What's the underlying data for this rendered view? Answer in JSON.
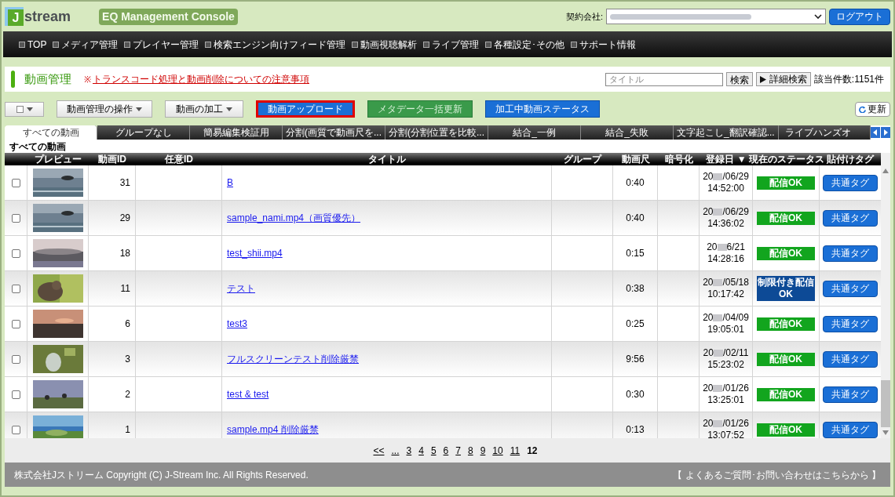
{
  "header": {
    "logo_mark": "J",
    "logo": "stream",
    "console_title": "EQ Management Console",
    "contract_label": "契約会社:",
    "logout": "ログアウト"
  },
  "nav": [
    "TOP",
    "メディア管理",
    "プレイヤー管理",
    "検索エンジン向けフィード管理",
    "動画視聴解析",
    "ライブ管理",
    "各種設定･その他",
    "サポート情報"
  ],
  "page_title": "動画管理",
  "notice_mark": "※",
  "notice_link": "トランスコード処理と動画削除についての注意事項",
  "search": {
    "placeholder": "タイトル",
    "button": "検索",
    "advanced": "詳細検索",
    "count": "該当件数:1151件"
  },
  "toolbar": [
    {
      "label": "動画管理の操作",
      "kind": "menu"
    },
    {
      "label": "動画の加工",
      "kind": "menu"
    },
    {
      "label": "動画アップロード",
      "kind": "highlight"
    },
    {
      "label": "メタデータ一括更新",
      "kind": "green"
    },
    {
      "label": "加工中動画ステータス",
      "kind": "blue"
    }
  ],
  "refresh": "更新",
  "tabs": [
    {
      "label": "すべての動画",
      "selected": true
    },
    {
      "label": "グループなし",
      "selected": false
    },
    {
      "label": "簡易編集検証用",
      "selected": false
    },
    {
      "label": "分割(画質で動画尺を...",
      "selected": false
    },
    {
      "label": "分割(分割位置を比較...",
      "selected": false
    },
    {
      "label": "結合_一例",
      "selected": false
    },
    {
      "label": "結合_失敗",
      "selected": false
    },
    {
      "label": "文字起こし_翻訳確認...",
      "selected": false
    },
    {
      "label": "ライブハンズオ",
      "selected": false
    }
  ],
  "tab_caption": "すべての動画",
  "table": {
    "columns": [
      "プレビュー",
      "動画ID",
      "任意ID",
      "タイトル",
      "グループ",
      "動画尺",
      "暗号化",
      "登録日 ▼",
      "現在のステータス",
      "貼付けタグ"
    ],
    "rows": [
      {
        "checked": false,
        "id": "31",
        "title": "B",
        "duration": "0:40",
        "date_start": "20",
        "date_end": "/06/29",
        "time": "14:52:00",
        "status": {
          "label": "配信OK",
          "color": "#12a51e"
        },
        "tag": "共通タグ"
      },
      {
        "checked": false,
        "id": "29",
        "title": "sample_nami.mp4（画質優先）",
        "duration": "0:40",
        "date_start": "20",
        "date_end": "/06/29",
        "time": "14:36:02",
        "status": {
          "label": "配信OK",
          "color": "#12a51e"
        },
        "tag": "共通タグ"
      },
      {
        "checked": false,
        "id": "18",
        "title": "test_shii.mp4",
        "duration": "0:15",
        "date_start": "20",
        "date_end": "6/21",
        "time": "14:28:16",
        "status": {
          "label": "配信OK",
          "color": "#12a51e"
        },
        "tag": "共通タグ"
      },
      {
        "checked": false,
        "id": "11",
        "title": "テスト",
        "duration": "0:38",
        "date_start": "20",
        "date_end": "/05/18",
        "time": "10:17:42",
        "status": {
          "label": "制限付き配信OK",
          "color": "#0d4a96"
        },
        "tag": "共通タグ"
      },
      {
        "checked": false,
        "id": "6",
        "title": "test3",
        "duration": "0:25",
        "date_start": "20",
        "date_end": "/04/09",
        "time": "19:05:01",
        "status": {
          "label": "配信OK",
          "color": "#12a51e"
        },
        "tag": "共通タグ"
      },
      {
        "checked": false,
        "id": "3",
        "title": "フルスクリーンテスト削除厳禁",
        "duration": "9:56",
        "date_start": "20",
        "date_end": "/02/11",
        "time": "15:23:02",
        "status": {
          "label": "配信OK",
          "color": "#12a51e"
        },
        "tag": "共通タグ"
      },
      {
        "checked": false,
        "id": "2",
        "title": "test & test",
        "duration": "0:30",
        "date_start": "20",
        "date_end": "/01/26",
        "time": "13:25:01",
        "status": {
          "label": "配信OK",
          "color": "#12a51e"
        },
        "tag": "共通タグ"
      },
      {
        "checked": false,
        "id": "1",
        "title": "sample.mp4 削除厳禁",
        "duration": "0:13",
        "date_start": "20",
        "date_end": "/01/26",
        "time": "13:07:52",
        "status": {
          "label": "配信OK",
          "color": "#12a51e"
        },
        "tag": "共通タグ"
      }
    ]
  },
  "pagination": [
    {
      "label": "<<",
      "selected": false
    },
    {
      "label": "...",
      "selected": false
    },
    {
      "label": "3",
      "selected": false
    },
    {
      "label": "4",
      "selected": false
    },
    {
      "label": "5",
      "selected": false
    },
    {
      "label": "6",
      "selected": false
    },
    {
      "label": "7",
      "selected": false
    },
    {
      "label": "8",
      "selected": false
    },
    {
      "label": "9",
      "selected": false
    },
    {
      "label": "10",
      "selected": false
    },
    {
      "label": "11",
      "selected": false
    },
    {
      "label": "12",
      "selected": true
    }
  ],
  "footer": {
    "copyright": "株式会社Jストリーム  Copyright (C) J-Stream Inc. All Rights Reserved.",
    "help": "【 よくあるご質問･お問い合わせはこちらから 】"
  }
}
